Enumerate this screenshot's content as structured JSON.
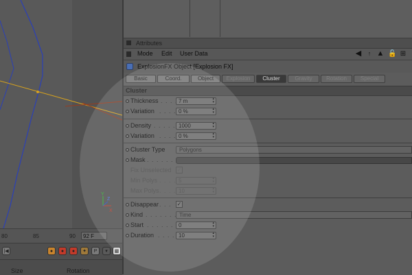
{
  "timeline": {
    "ticks": [
      "80",
      "85",
      "90"
    ],
    "frame_value": "92 F"
  },
  "bottom_panel": {
    "columns": [
      "Size",
      "Rotation"
    ]
  },
  "attributes": {
    "panel_title": "Attributes",
    "menu": [
      "Mode",
      "Edit",
      "User Data"
    ],
    "object_title": "ExplosionFX Object [Explosion FX]",
    "tabs": [
      {
        "label": "Basic",
        "state": "normal"
      },
      {
        "label": "Coord.",
        "state": "normal"
      },
      {
        "label": "Object",
        "state": "normal"
      },
      {
        "label": "Explosion",
        "state": "dim"
      },
      {
        "label": "Cluster",
        "state": "active"
      },
      {
        "label": "Gravity",
        "state": "dim"
      },
      {
        "label": "Rotation",
        "state": "dim"
      },
      {
        "label": "Special",
        "state": "dim"
      }
    ],
    "section_title": "Cluster",
    "thickness": {
      "label": "Thickness",
      "dots": ". . . .",
      "value": "7 m"
    },
    "thickness_variation": {
      "label": "Variation",
      "dots": ". . . .",
      "value": "0 %"
    },
    "density": {
      "label": "Density",
      "dots": ". . . . . .",
      "value": "1000"
    },
    "density_variation": {
      "label": "Variation",
      "dots": ". . . .",
      "value": "0 %"
    },
    "cluster_type": {
      "label": "Cluster Type",
      "value": "Polygons"
    },
    "mask": {
      "label": "Mask",
      "dots": ". . . . . . . ."
    },
    "fix_unselected": {
      "label": "Fix Unselected",
      "checked": true
    },
    "min_polys": {
      "label": "Min Polys",
      "dots": ". . . .",
      "value": "5"
    },
    "max_polys": {
      "label": "Max Polys",
      "dots": ". . . .",
      "value": "10"
    },
    "disappear": {
      "label": "Disappear",
      "dots": ". . .",
      "checked": true
    },
    "kind": {
      "label": "Kind",
      "dots": ". . . . . . . .",
      "value": "Time"
    },
    "start": {
      "label": "Start",
      "dots": ". . . . . . .",
      "value": "0"
    },
    "duration": {
      "label": "Duration",
      "dots": ". . . . .",
      "value": "10"
    }
  },
  "colors": {
    "spline": "#2a3fb8",
    "axis_line": "#d7a21e",
    "active_tab": "#393939",
    "spotlight": "rgba(255,255,255,0.13)"
  }
}
